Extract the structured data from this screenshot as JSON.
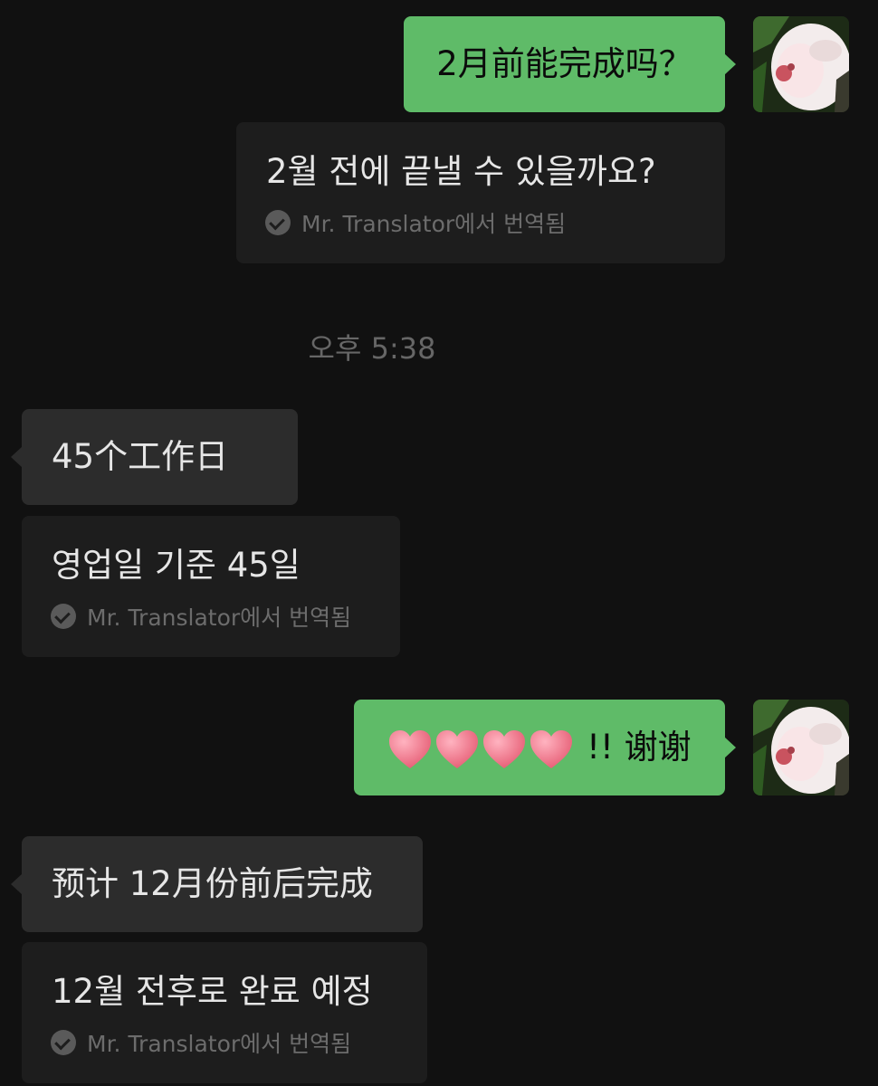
{
  "messages": {
    "m1": {
      "text": "2月前能完成吗？",
      "translation": "2월 전에 끝낼 수 있을까요?",
      "translated_by": "Mr. Translator에서 번역됨"
    },
    "timestamp": "오후 5:38",
    "m2": {
      "text": "45个工作日",
      "translation": "영업일 기준 45일",
      "translated_by": "Mr. Translator에서 번역됨"
    },
    "m3": {
      "text": "!! 谢谢",
      "emoji": "heart-emoji",
      "emoji_count": 4
    },
    "m4": {
      "text": "预计 12月份前后完成",
      "translation": "12월 전후로 완료 예정",
      "translated_by": "Mr. Translator에서 번역됨"
    }
  },
  "colors": {
    "background": "#111111",
    "outgoing_bubble": "#5fbb68",
    "incoming_bubble": "#2c2c2c",
    "translation_card": "#1d1d1d"
  }
}
